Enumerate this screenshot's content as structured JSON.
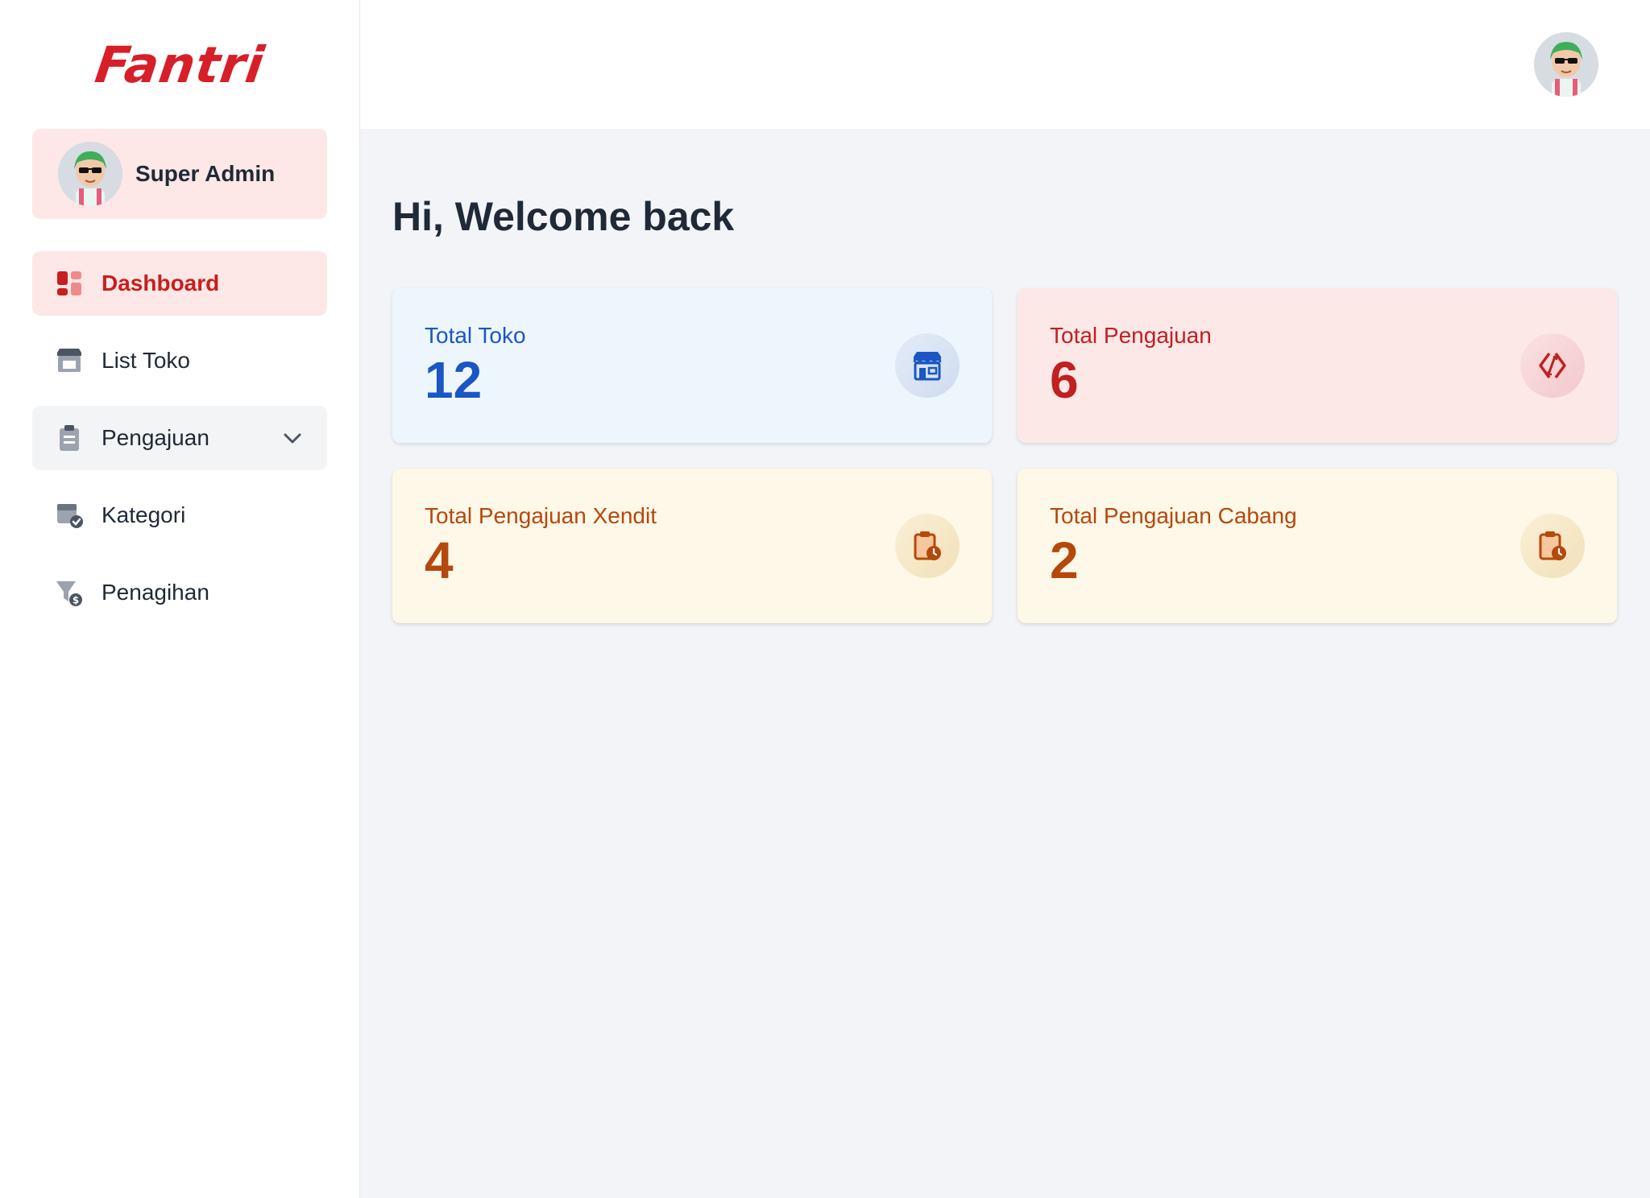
{
  "brand": {
    "logo_text": "Fantri",
    "accent": "#d71f2a"
  },
  "user": {
    "name": "Super Admin"
  },
  "sidebar": {
    "items": [
      {
        "label": "Dashboard",
        "icon": "dashboard-icon",
        "active": true
      },
      {
        "label": "List Toko",
        "icon": "store-icon"
      },
      {
        "label": "Pengajuan",
        "icon": "clipboard-icon",
        "expandable": true
      },
      {
        "label": "Kategori",
        "icon": "category-check-icon"
      },
      {
        "label": "Penagihan",
        "icon": "funnel-dollar-icon"
      }
    ]
  },
  "main": {
    "welcome": "Hi, Welcome back",
    "cards": [
      {
        "label": "Total Toko",
        "value": "12",
        "color": "#1a56c4",
        "icon": "store-icon"
      },
      {
        "label": "Total Pengajuan",
        "value": "6",
        "color": "#c0201f",
        "icon": "exchange-icon"
      },
      {
        "label": "Total Pengajuan Xendit",
        "value": "4",
        "color": "#b5480c",
        "icon": "clipboard-clock-icon"
      },
      {
        "label": "Total Pengajuan Cabang",
        "value": "2",
        "color": "#b5480c",
        "icon": "clipboard-clock-icon"
      }
    ]
  }
}
